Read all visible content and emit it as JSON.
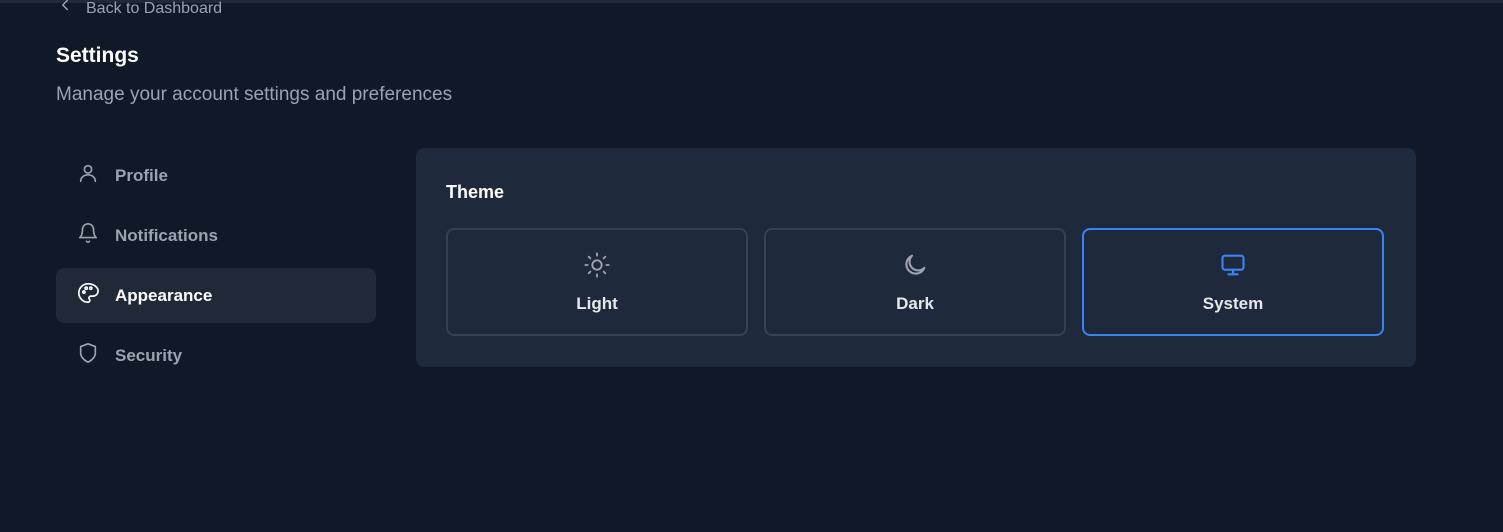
{
  "back_link": {
    "label": "Back to Dashboard",
    "icon": "chevron-left-icon"
  },
  "header": {
    "title": "Settings",
    "subtitle": "Manage your account settings and preferences"
  },
  "sidebar": {
    "items": [
      {
        "label": "Profile",
        "icon": "user-icon",
        "active": false
      },
      {
        "label": "Notifications",
        "icon": "bell-icon",
        "active": false
      },
      {
        "label": "Appearance",
        "icon": "palette-icon",
        "active": true
      },
      {
        "label": "Security",
        "icon": "shield-icon",
        "active": false
      }
    ]
  },
  "theme": {
    "title": "Theme",
    "options": [
      {
        "label": "Light",
        "icon": "sun-icon",
        "selected": false
      },
      {
        "label": "Dark",
        "icon": "moon-icon",
        "selected": false
      },
      {
        "label": "System",
        "icon": "monitor-icon",
        "selected": true
      }
    ]
  },
  "colors": {
    "background": "#111827",
    "panel": "#1e293b",
    "active_nav": "#1f2937",
    "accent": "#3b82f6",
    "muted_text": "#9ca3af"
  }
}
